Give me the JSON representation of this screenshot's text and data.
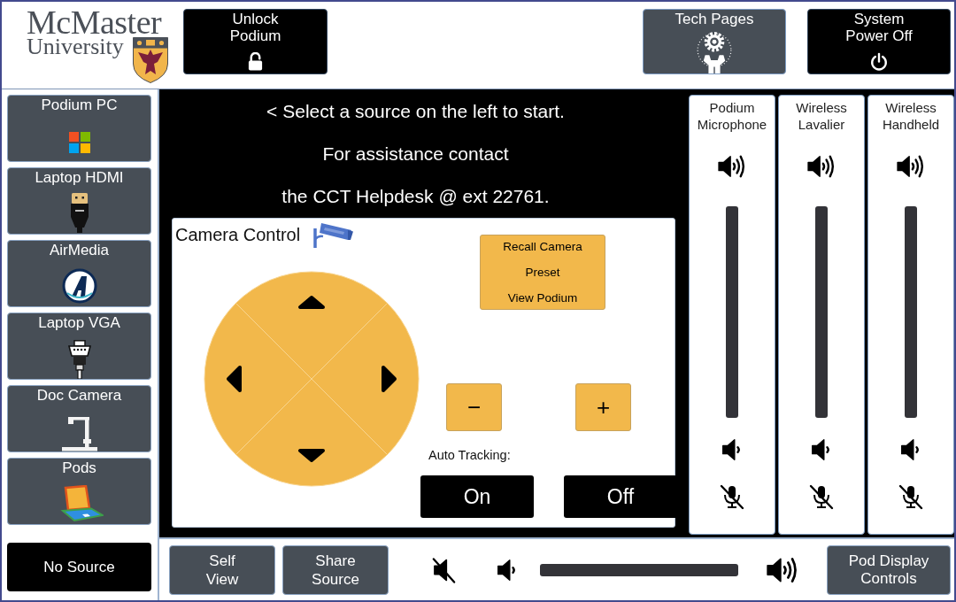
{
  "header": {
    "logo": {
      "wordmark": "McMaster",
      "subtitle": "University"
    },
    "buttons": [
      {
        "lines": [
          "Unlock",
          "Podium"
        ]
      },
      {
        "lines": [
          "Tech Pages"
        ]
      },
      {
        "lines": [
          "System",
          "Power Off"
        ]
      }
    ]
  },
  "sources": {
    "items": [
      {
        "label": "Podium PC",
        "selected": false
      },
      {
        "label": "Laptop HDMI",
        "selected": false
      },
      {
        "label": "AirMedia",
        "selected": false
      },
      {
        "label": "Laptop VGA",
        "selected": false
      },
      {
        "label": "Doc Camera",
        "selected": false
      },
      {
        "label": "Pods",
        "selected": false
      }
    ],
    "no_source": {
      "label": "No Source"
    }
  },
  "instructions": [
    "< Select a source on the left to start.",
    "For assistance contact",
    "the CCT Helpdesk @ ext 22761."
  ],
  "camera": {
    "title": "Camera Control",
    "preset": {
      "lines": [
        "Recall Camera",
        "Preset",
        "View Podium"
      ]
    },
    "zoom": [
      {
        "label": "−"
      },
      {
        "label": "+"
      }
    ],
    "auto_tracking": {
      "label": "Auto Tracking:",
      "options": [
        {
          "label": "On",
          "selected": false
        },
        {
          "label": "Off",
          "selected": false
        }
      ]
    }
  },
  "audio_channels": [
    {
      "name": "Podium Microphone"
    },
    {
      "name": "Wireless Lavalier"
    },
    {
      "name": "Wireless Handheld"
    }
  ],
  "bottom_bar": {
    "buttons": [
      {
        "lines": [
          "Self",
          "View"
        ]
      },
      {
        "lines": [
          "Share",
          "Source"
        ]
      }
    ],
    "right_button": {
      "lines": [
        "Pod Display",
        "Controls"
      ]
    }
  }
}
